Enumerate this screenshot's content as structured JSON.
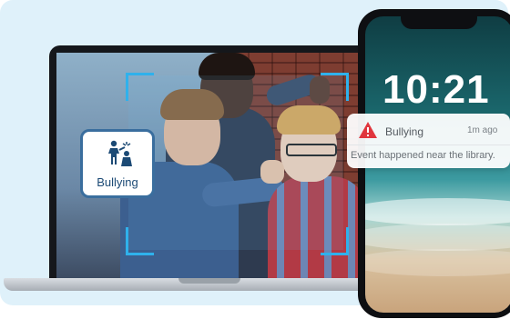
{
  "detection_tag": {
    "label": "Bullying",
    "icon": "bullying-person-icon"
  },
  "phone": {
    "clock": "10:21",
    "notification": {
      "icon": "warning-triangle-icon",
      "title": "Bullying",
      "time": "1m ago",
      "body": "Event happened near the library."
    }
  },
  "colors": {
    "background": "#dff1fa",
    "bracket": "#2fb1ec",
    "tag_border": "#3a6e9e",
    "warning": "#e0353d"
  }
}
